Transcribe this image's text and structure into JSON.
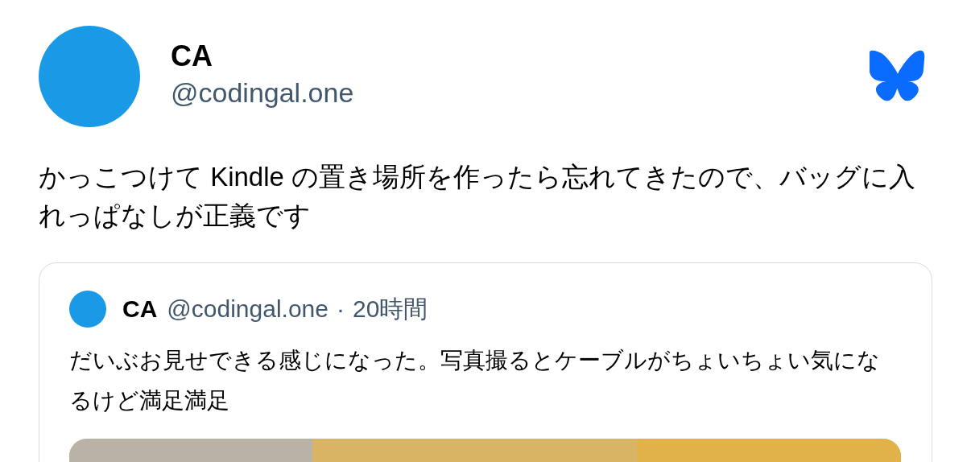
{
  "author": {
    "name": "CA",
    "handle": "@codingal.one"
  },
  "text": "かっこつけて Kindle の置き場所を作ったら忘れてきたので、バッグに入れっぱなしが正義です",
  "quote": {
    "author": {
      "name": "CA",
      "handle": "@codingal.one"
    },
    "separator": "·",
    "time": "20時間",
    "text": "だいぶお見せできる感じになった。写真撮るとケーブルがちょいちょい気になるけど満足満足"
  }
}
